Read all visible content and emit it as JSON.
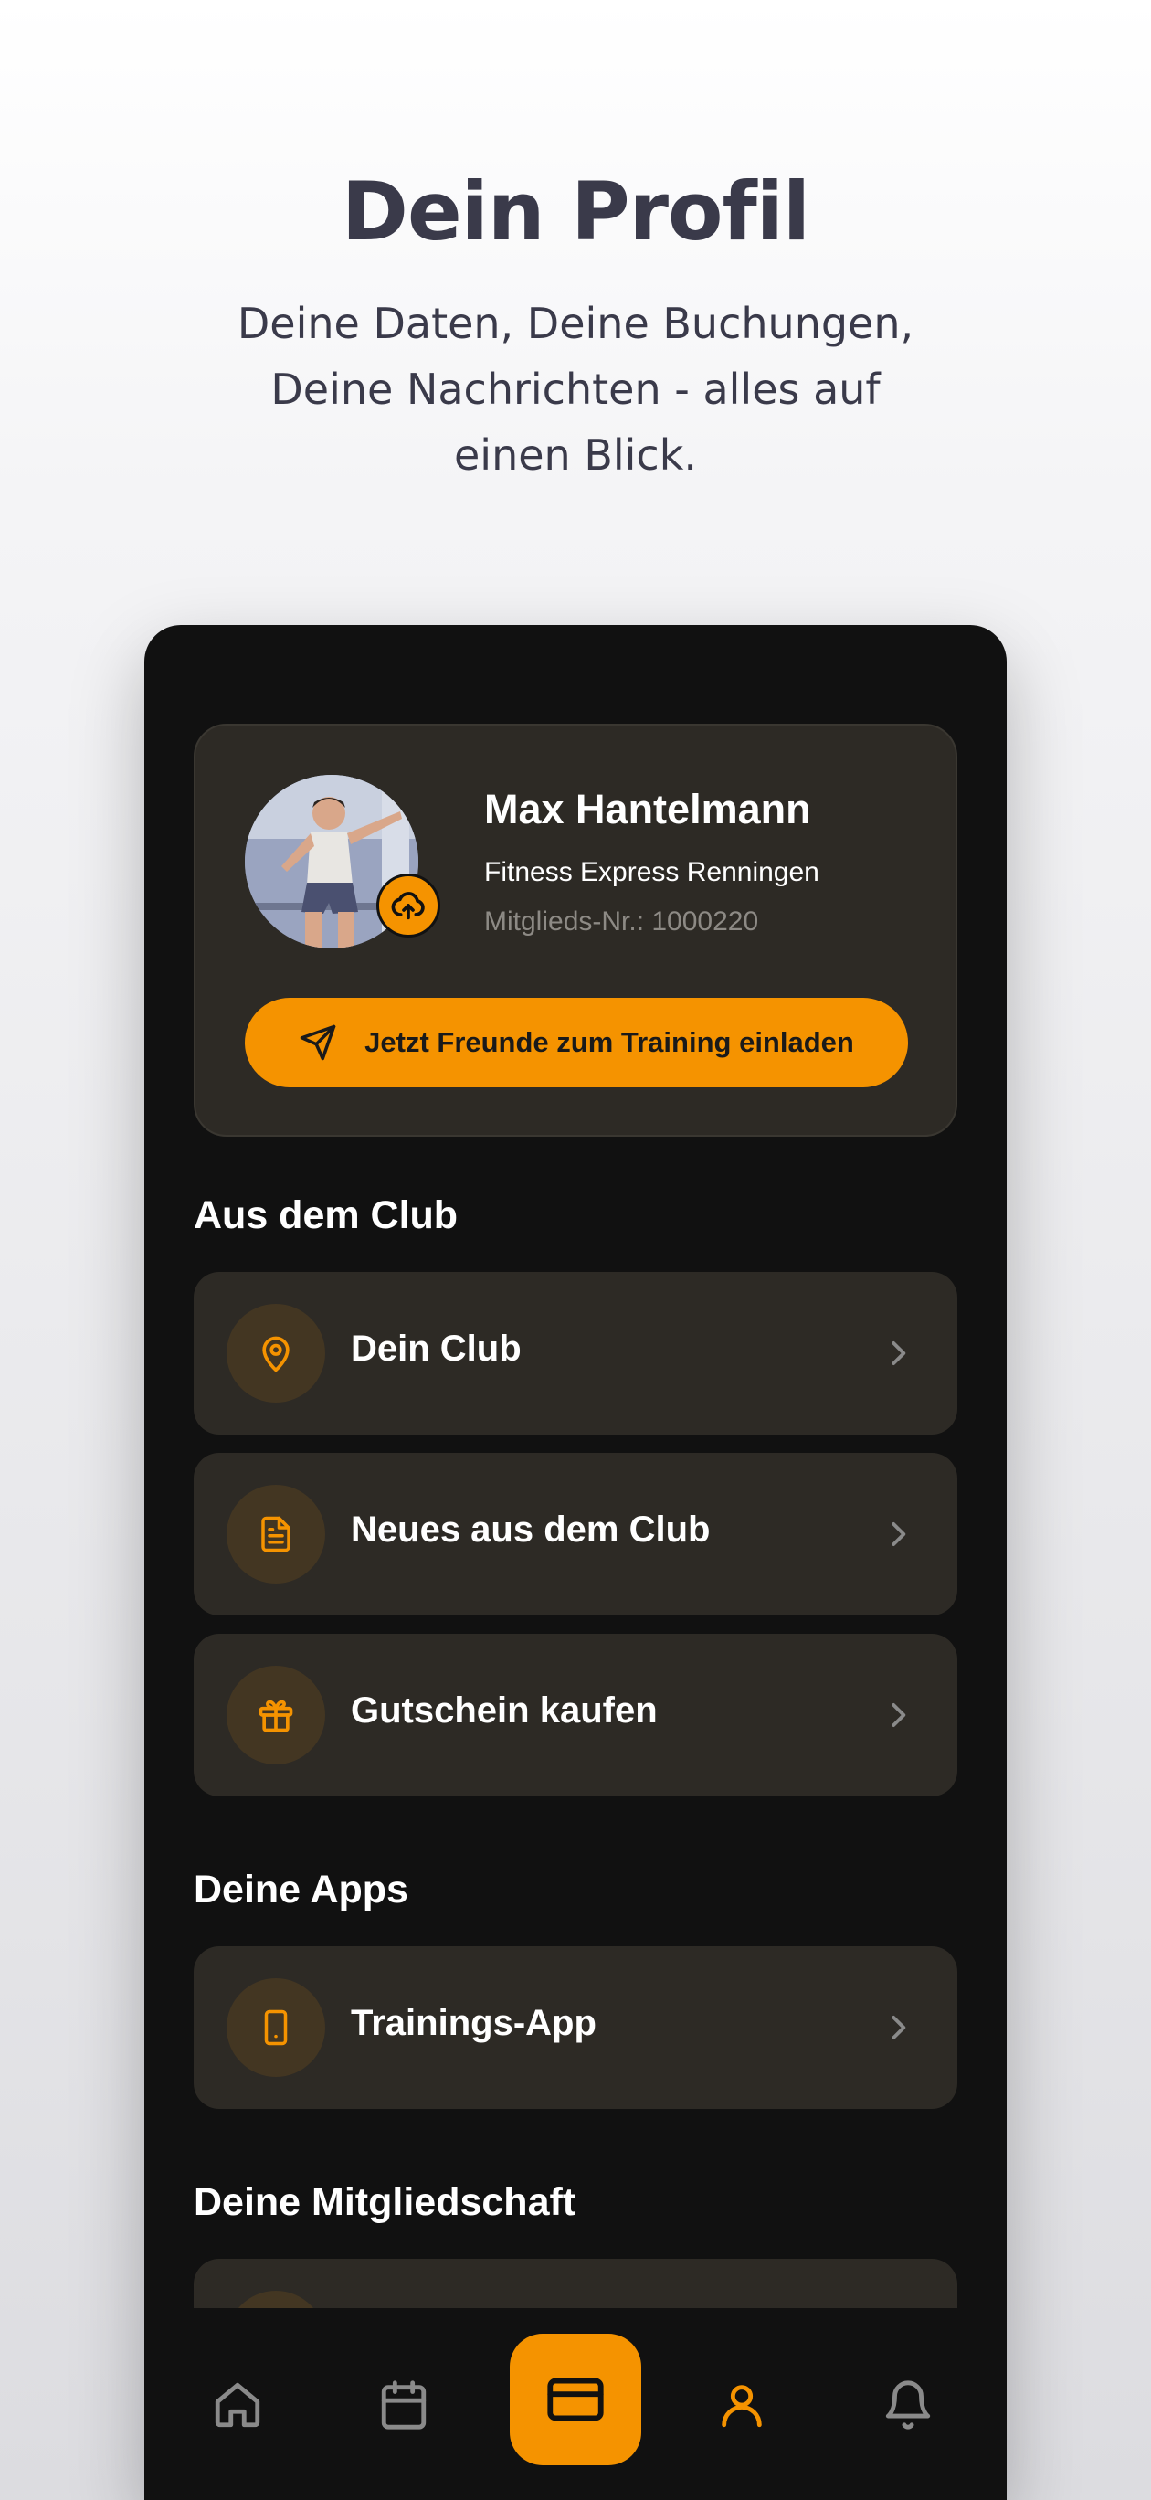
{
  "promo": {
    "title": "Dein Profil",
    "subtitle": "Deine Daten, Deine Buchungen, Deine Nachrichten - alles auf einen Blick."
  },
  "profile": {
    "name": "Max Hantelmann",
    "club": "Fitness Express Renningen",
    "member_number": "Mitglieds-Nr.: 1000220",
    "invite_label": "Jetzt Freunde zum Training einladen"
  },
  "sections": {
    "club_title": "Aus dem Club",
    "apps_title": "Deine Apps",
    "membership_title": "Deine Mitgliedschaft"
  },
  "club_items": [
    {
      "label": "Dein Club",
      "icon": "location-pin-icon"
    },
    {
      "label": "Neues aus dem Club",
      "icon": "document-icon"
    },
    {
      "label": "Gutschein kaufen",
      "icon": "gift-icon"
    }
  ],
  "app_items": [
    {
      "label": "Trainings-App",
      "icon": "phone-icon"
    }
  ],
  "nav": [
    {
      "icon": "home-icon",
      "active": false
    },
    {
      "icon": "calendar-icon",
      "active": false
    },
    {
      "icon": "card-icon",
      "active": true
    },
    {
      "icon": "user-icon",
      "active": false
    },
    {
      "icon": "bell-icon",
      "active": false
    }
  ],
  "colors": {
    "accent": "#f59300",
    "background": "#111111",
    "card": "#2d2a25",
    "icon_circle": "#433622",
    "nav_inactive": "#8a8a8a"
  }
}
